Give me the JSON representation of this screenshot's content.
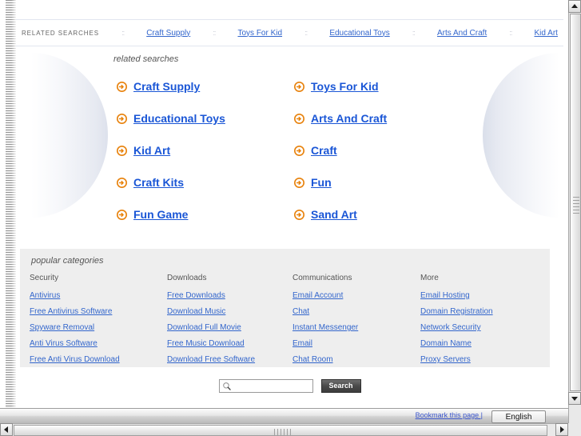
{
  "top_bar": {
    "label": "RELATED SEARCHES",
    "separator": "::",
    "items": [
      "Craft Supply",
      "Toys For Kid",
      "Educational Toys",
      "Arts And Craft",
      "Kid Art"
    ]
  },
  "related": {
    "heading": "related searches",
    "bullet_icon": "arrow-circle-icon",
    "links": [
      "Craft Supply",
      "Toys For Kid",
      "Educational Toys",
      "Arts And Craft",
      "Kid Art",
      "Craft",
      "Craft Kits",
      "Fun",
      "Fun Game",
      "Sand Art"
    ]
  },
  "categories": {
    "heading": "popular categories",
    "columns": [
      {
        "title": "Security",
        "links": [
          "Antivirus",
          "Free Antivirus Software",
          "Spyware Removal",
          "Anti Virus Software",
          "Free Anti Virus Download"
        ]
      },
      {
        "title": "Downloads",
        "links": [
          "Free Downloads",
          "Download Music",
          "Download Full Movie",
          "Free Music Download",
          "Download Free Software"
        ]
      },
      {
        "title": "Communications",
        "links": [
          "Email Account",
          "Chat",
          "Instant Messenger",
          "Email",
          "Chat Room"
        ]
      },
      {
        "title": "More",
        "links": [
          "Email Hosting",
          "Domain Registration",
          "Network Security",
          "Domain Name",
          "Proxy Servers"
        ]
      }
    ]
  },
  "search": {
    "value": "",
    "placeholder": "",
    "button_label": "Search",
    "icon": "magnifier-icon"
  },
  "footer": {
    "bookmark_label": "Bookmark this page |",
    "language_value": "English"
  },
  "colors": {
    "link_blue": "#3366cc",
    "big_link_blue": "#1a56d6",
    "arrow_orange": "#e8820c",
    "panel_gray": "#eeeeee",
    "button_dark": "#4a4a4a"
  }
}
